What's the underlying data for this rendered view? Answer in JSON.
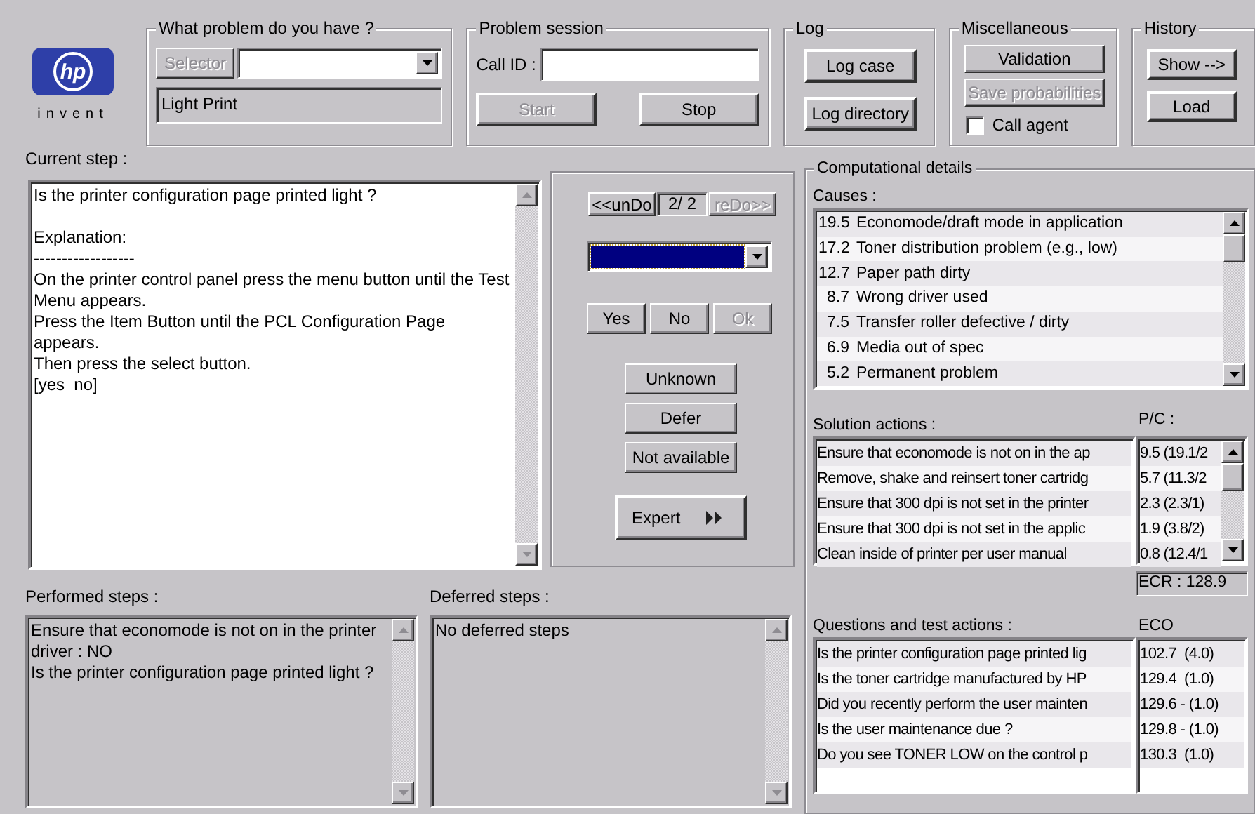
{
  "logo": {
    "mark": "hp",
    "tagline": "invent"
  },
  "problem": {
    "title": "What problem do you have ?",
    "selector": {
      "label": "Selector",
      "disabled": true
    },
    "selected_problem": "Light Print"
  },
  "session": {
    "title": "Problem session",
    "call_id_label": "Call ID :",
    "buttons": [
      {
        "label": "Start",
        "disabled": true
      },
      {
        "label": "Stop",
        "disabled": false
      }
    ]
  },
  "log": {
    "title": "Log",
    "buttons": [
      {
        "label": "Log case",
        "disabled": false
      },
      {
        "label": "Log directory",
        "disabled": false
      }
    ]
  },
  "misc": {
    "title": "Miscellaneous",
    "buttons": [
      {
        "label": "Validation",
        "disabled": false
      },
      {
        "label": "Save probabilities",
        "disabled": true
      }
    ],
    "checkbox": {
      "label": "Call agent",
      "checked": false
    }
  },
  "history": {
    "title": "History",
    "buttons": [
      {
        "label": "Show -->",
        "disabled": false
      },
      {
        "label": "Load",
        "disabled": false
      }
    ]
  },
  "current_step": {
    "label": "Current step :",
    "text": "Is the printer configuration page printed light ?\n\nExplanation:\n------------------\nOn the printer control panel press the menu button until the Test Menu appears.\nPress the Item Button until the PCL Configuration Page appears.\nThen press the select button.\n[yes  no]"
  },
  "navigation": {
    "undo": {
      "label": "<<unDo",
      "disabled": false
    },
    "counter": "2/ 2",
    "redo": {
      "label": "reDo>>",
      "disabled": true
    }
  },
  "answers": [
    {
      "label": "Yes",
      "disabled": false
    },
    {
      "label": "No",
      "disabled": false
    },
    {
      "label": "Ok",
      "disabled": true
    }
  ],
  "options": [
    {
      "label": "Unknown",
      "disabled": false
    },
    {
      "label": "Defer",
      "disabled": false
    },
    {
      "label": "Not available",
      "disabled": false
    }
  ],
  "expert": {
    "label": "Expert"
  },
  "performed": {
    "label": "Performed steps :",
    "text": "Ensure that economode is not on in the printer driver : NO\nIs the printer configuration page printed light ?"
  },
  "deferred": {
    "label": "Deferred steps :",
    "text": "No deferred steps"
  },
  "computational": {
    "title": "Computational details",
    "causes": {
      "label": "Causes :",
      "items": [
        {
          "score": "19.5",
          "text": "Economode/draft mode in application"
        },
        {
          "score": "17.2",
          "text": "Toner distribution problem (e.g., low)"
        },
        {
          "score": "12.7",
          "text": "Paper path dirty"
        },
        {
          "score": "8.7",
          "text": "Wrong driver used"
        },
        {
          "score": "7.5",
          "text": "Transfer roller defective / dirty"
        },
        {
          "score": "6.9",
          "text": "Media out of spec"
        },
        {
          "score": "5.2",
          "text": "Permanent problem"
        }
      ]
    },
    "solutions": {
      "label": "Solution actions :",
      "pc_label": "P/C :",
      "rows": [
        {
          "action": "Ensure that economode is not on in the ap",
          "pc": "9.5 (19.1/2"
        },
        {
          "action": "Remove, shake and reinsert toner cartridg",
          "pc": "5.7 (11.3/2"
        },
        {
          "action": "Ensure that 300 dpi is not set in the printer",
          "pc": "2.3 (2.3/1)"
        },
        {
          "action": "Ensure that 300 dpi is not set in the applic",
          "pc": "1.9 (3.8/2)"
        },
        {
          "action": "Clean inside of printer per user manual",
          "pc": "0.8 (12.4/1"
        }
      ],
      "ecr": "ECR : 128.9"
    },
    "questions": {
      "label": "Questions and test actions :",
      "eco_label": "ECO",
      "rows": [
        {
          "question": "Is the printer configuration page printed lig",
          "eco": "102.7  (4.0)"
        },
        {
          "question": "Is the toner cartridge manufactured by HP",
          "eco": "129.4  (1.0)"
        },
        {
          "question": "Did you recently perform the user mainten",
          "eco": "129.6 - (1.0)"
        },
        {
          "question": "Is the user maintenance due ?",
          "eco": "129.8 - (1.0)"
        },
        {
          "question": "Do you see TONER LOW on the control p",
          "eco": "130.3  (1.0)"
        }
      ]
    }
  }
}
